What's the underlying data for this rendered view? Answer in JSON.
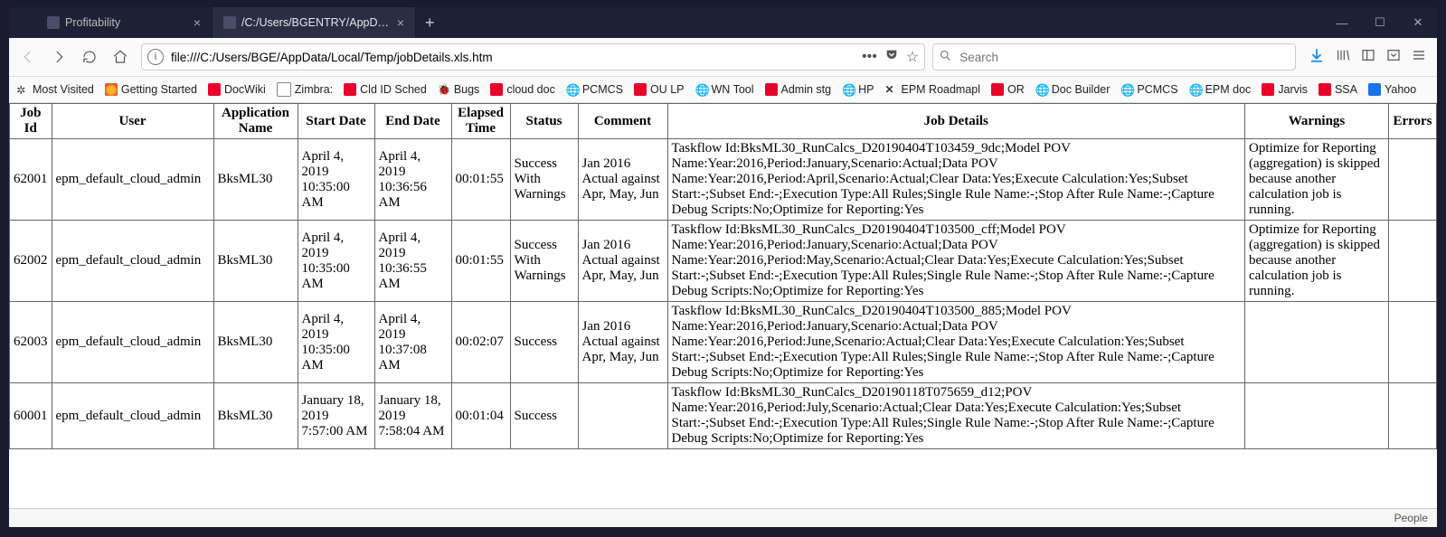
{
  "tabs": {
    "tab0_label": "Profitability",
    "tab1_label": "/C:/Users/BGENTRY/AppData/Loca"
  },
  "url": "file:///C:/Users/BGE/AppData/Local/Temp/jobDetails.xls.htm",
  "search_placeholder": "Search",
  "bookmarks": {
    "b0": "Most Visited",
    "b1": "Getting Started",
    "b2": "DocWiki",
    "b3": "Zimbra:",
    "b4": "Cld ID Sched",
    "b5": "Bugs",
    "b6": "cloud doc",
    "b7": "PCMCS",
    "b8": "OU LP",
    "b9": "WN Tool",
    "b10": "Admin stg",
    "b11": "HP",
    "b12": "EPM Roadmapl",
    "b13": "OR",
    "b14": "Doc Builder",
    "b15": "PCMCS",
    "b16": "EPM doc",
    "b17": "Jarvis",
    "b18": "SSA",
    "b19": "Yahoo"
  },
  "headers": {
    "jobid": "Job Id",
    "user": "User",
    "app": "Application Name",
    "start": "Start Date",
    "end": "End Date",
    "elapsed": "Elapsed Time",
    "status": "Status",
    "comment": "Comment",
    "details": "Job Details",
    "warnings": "Warnings",
    "errors": "Errors"
  },
  "rows": {
    "r0": {
      "jobid": "62001",
      "user": "epm_default_cloud_admin",
      "app": "BksML30",
      "start": "April 4, 2019 10:35:00 AM",
      "end": "April 4, 2019 10:36:56 AM",
      "elapsed": "00:01:55",
      "status": "Success With Warnings",
      "comment": "Jan 2016 Actual against Apr, May, Jun",
      "details": "Taskflow Id:BksML30_RunCalcs_D20190404T103459_9dc;Model POV Name:Year:2016,Period:January,Scenario:Actual;Data POV Name:Year:2016,Period:April,Scenario:Actual;Clear Data:Yes;Execute Calculation:Yes;Subset Start:-;Subset End:-;Execution Type:All Rules;Single Rule Name:-;Stop After Rule Name:-;Capture Debug Scripts:No;Optimize for Reporting:Yes",
      "warnings": "Optimize for Reporting (aggregation) is skipped because another calculation job is running.",
      "errors": ""
    },
    "r1": {
      "jobid": "62002",
      "user": "epm_default_cloud_admin",
      "app": "BksML30",
      "start": "April 4, 2019 10:35:00 AM",
      "end": "April 4, 2019 10:36:55 AM",
      "elapsed": "00:01:55",
      "status": "Success With Warnings",
      "comment": "Jan 2016 Actual against Apr, May, Jun",
      "details": "Taskflow Id:BksML30_RunCalcs_D20190404T103500_cff;Model POV Name:Year:2016,Period:January,Scenario:Actual;Data POV Name:Year:2016,Period:May,Scenario:Actual;Clear Data:Yes;Execute Calculation:Yes;Subset Start:-;Subset End:-;Execution Type:All Rules;Single Rule Name:-;Stop After Rule Name:-;Capture Debug Scripts:No;Optimize for Reporting:Yes",
      "warnings": "Optimize for Reporting (aggregation) is skipped because another calculation job is running.",
      "errors": ""
    },
    "r2": {
      "jobid": "62003",
      "user": "epm_default_cloud_admin",
      "app": "BksML30",
      "start": "April 4, 2019 10:35:00 AM",
      "end": "April 4, 2019 10:37:08 AM",
      "elapsed": "00:02:07",
      "status": "Success",
      "comment": "Jan 2016 Actual against Apr, May, Jun",
      "details": "Taskflow Id:BksML30_RunCalcs_D20190404T103500_885;Model POV Name:Year:2016,Period:January,Scenario:Actual;Data POV Name:Year:2016,Period:June,Scenario:Actual;Clear Data:Yes;Execute Calculation:Yes;Subset Start:-;Subset End:-;Execution Type:All Rules;Single Rule Name:-;Stop After Rule Name:-;Capture Debug Scripts:No;Optimize for Reporting:Yes",
      "warnings": "",
      "errors": ""
    },
    "r3": {
      "jobid": "60001",
      "user": "epm_default_cloud_admin",
      "app": "BksML30",
      "start": "January 18, 2019 7:57:00 AM",
      "end": "January 18, 2019 7:58:04 AM",
      "elapsed": "00:01:04",
      "status": "Success",
      "comment": "",
      "details": "Taskflow Id:BksML30_RunCalcs_D20190118T075659_d12;POV Name:Year:2016,Period:July,Scenario:Actual;Clear Data:Yes;Execute Calculation:Yes;Subset Start:-;Subset End:-;Execution Type:All Rules;Single Rule Name:-;Stop After Rule Name:-;Capture Debug Scripts:No;Optimize for Reporting:Yes",
      "warnings": "",
      "errors": ""
    }
  },
  "status_people": "People"
}
